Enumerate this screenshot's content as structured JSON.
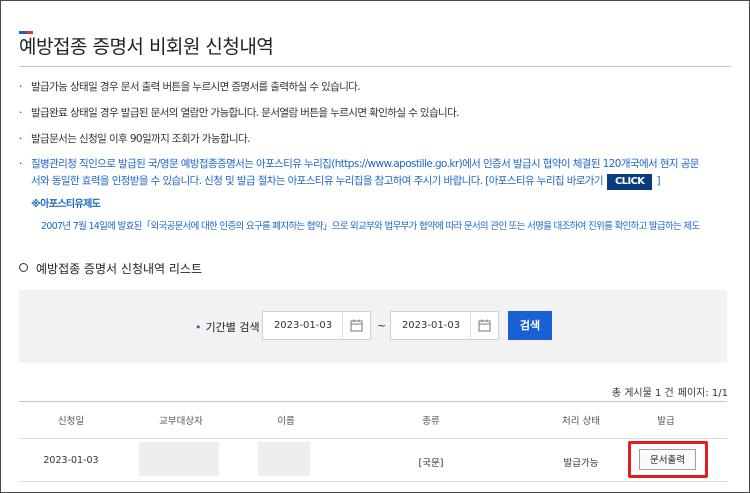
{
  "colors": {
    "accent_blue": "#1a5fd4",
    "accent_red": "#d8323c",
    "link_blue": "#1f66c9",
    "highlight_red": "#e01e1e"
  },
  "header": {
    "title": "예방접종 증명서 비회원 신청내역"
  },
  "notices": {
    "item1": "발급가능 상태일 경우 문서 출력 버튼을 누르시면 증명서를 출력하실 수 있습니다.",
    "item2": "발급완료 상태일 경우 발급된 문서의 열람만 가능합니다. 문서열람 버튼을 누르시면 확인하실 수 있습니다.",
    "item3": "발급문서는 신청일 이후 90일까지 조회가 가능합니다.",
    "item4_line1": "질병관리청 직인으로 발급된 국/영문 예방접종증명서는 아포스티유 누리집(https://www.apostille.go.kr)에서 인증서 발급시 협약이 체결된 120개국에서 현지 공문",
    "item4_line2": "서와 동일한 효력을 인정받을 수 있습니다. 신청 및 발급 절차는 아포스티유 누리집을 참고하여 주시기 바랍니다. [아포스티유 누리집 바로가기",
    "click_label": "CLICK",
    "item4_close": "]",
    "apostille_heading": "※아포스티유제도",
    "apostille_desc": "2007년 7월 14일에 발효된「외국공문서에 대한 인증의 요구를 폐지하는 협약」으로 외교부와 법무부가 협약에 따라 문서의 관인 또는 서명을 대조하여 진위를 확인하고 발급하는 제도"
  },
  "list": {
    "heading": "예방접종 증명서 신청내역 리스트"
  },
  "search": {
    "label": "기간별 검색",
    "start_date": "2023-01-03",
    "tilde": "~",
    "end_date": "2023-01-03",
    "button": "검색"
  },
  "meta": {
    "total": "총 게시물 1 건",
    "page": "페이지: 1/1"
  },
  "table": {
    "headers": [
      "신청일",
      "교부대상자",
      "이름",
      "종류",
      "처리 상태",
      "발급"
    ],
    "rows": [
      {
        "date": "2023-01-03",
        "kind": "[국문]",
        "status": "발급가능",
        "action": "문서출력"
      }
    ]
  }
}
